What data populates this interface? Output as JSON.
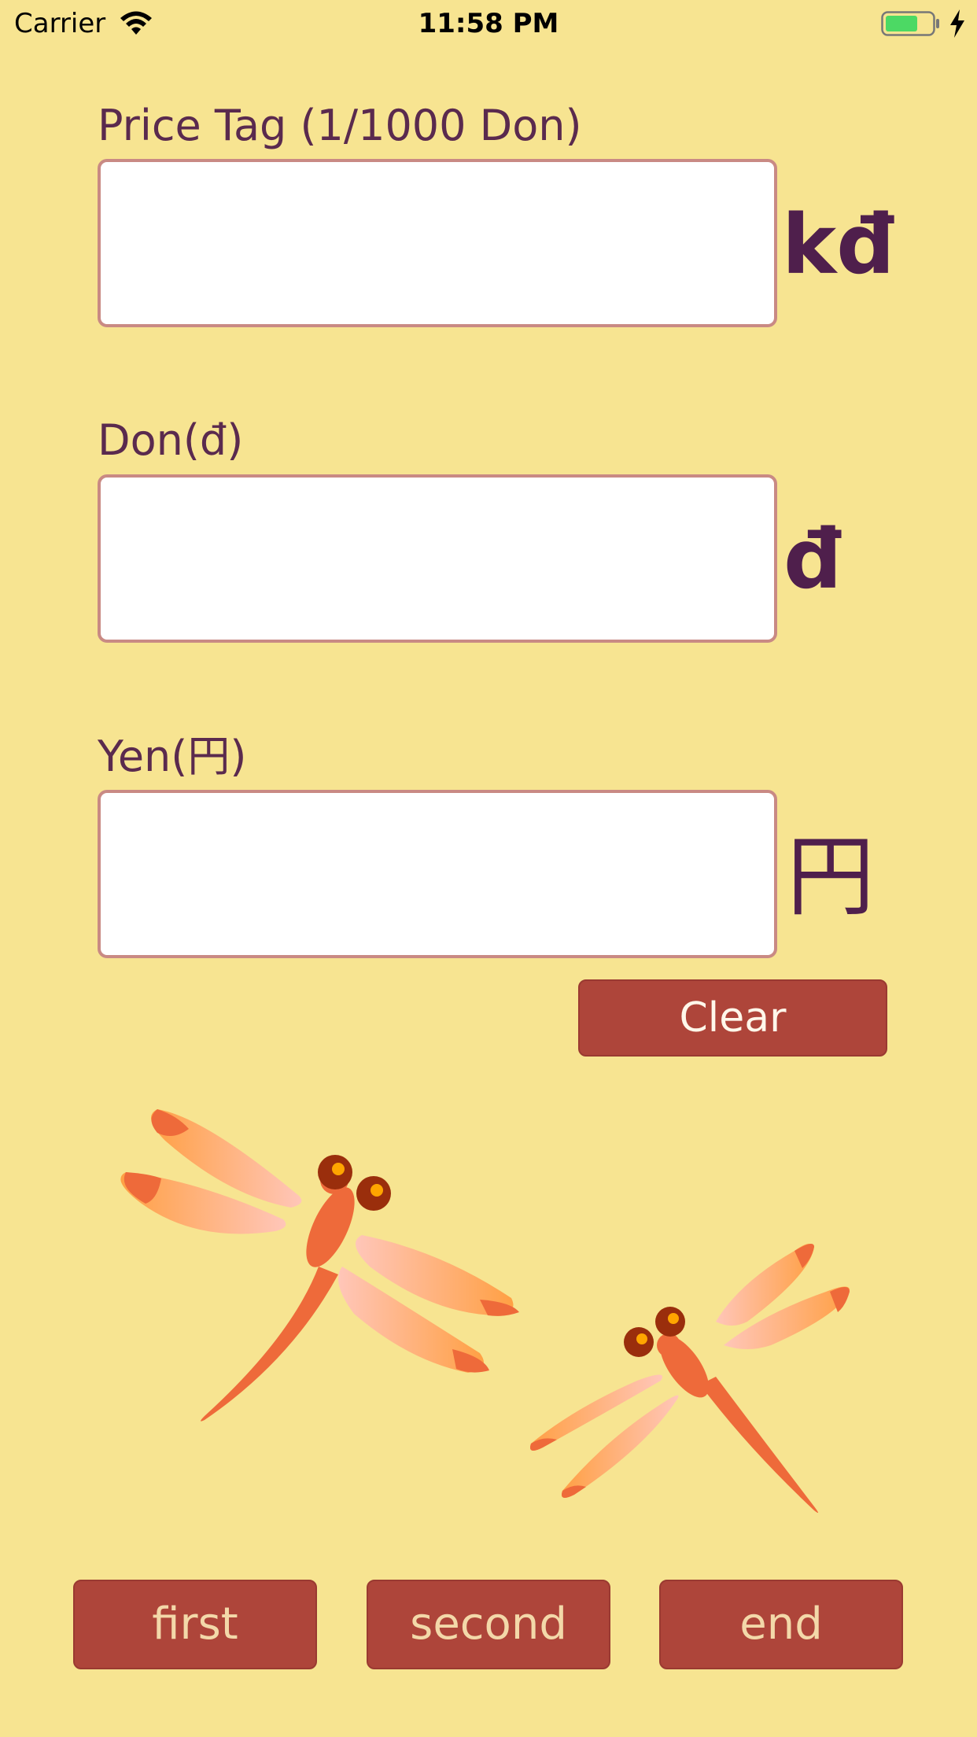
{
  "status_bar": {
    "carrier": "Carrier",
    "time": "11:58 PM",
    "battery_color": "#4cd964"
  },
  "fields": [
    {
      "label": "Price Tag (1/1000 Don)",
      "value": "",
      "placeholder": "",
      "unit": "kđ"
    },
    {
      "label": "Don(đ)",
      "value": "",
      "placeholder": "",
      "unit": "đ"
    },
    {
      "label": "Yen(円)",
      "value": "",
      "placeholder": "",
      "unit": "円"
    }
  ],
  "clear_button": {
    "label": "Clear"
  },
  "tabs": [
    {
      "label": "first"
    },
    {
      "label": "second"
    },
    {
      "label": "end"
    }
  ],
  "colors": {
    "background": "#f7e491",
    "button": "#ae453a",
    "label_text": "#5a2a4e",
    "unit_text": "#4f1f4c",
    "input_border": "#c98a84",
    "dragonfly_body": "#ee6a3a",
    "dragonfly_eye": "#9a2e0c"
  },
  "illustration": {
    "icon": "dragonfly-icon"
  }
}
